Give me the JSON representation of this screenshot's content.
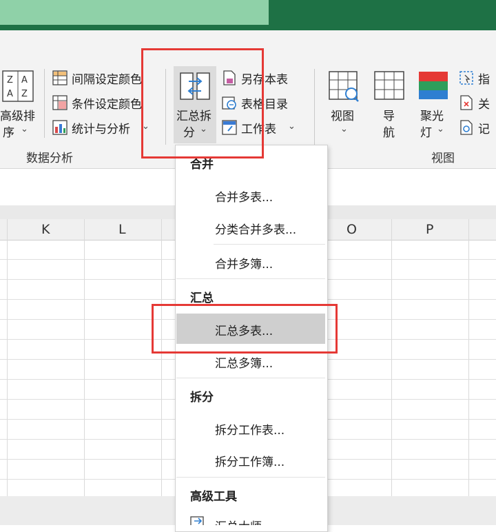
{
  "ribbon": {
    "sort": {
      "label_line1": "高级排",
      "label_line2": "序",
      "chevron": "⌄",
      "icon": "sort-az-icon"
    },
    "data_analysis": {
      "items": [
        {
          "label": "间隔设定颜色",
          "icon": "interval-color-icon"
        },
        {
          "label": "条件设定颜色",
          "icon": "condition-color-icon"
        },
        {
          "label": "统计与分析",
          "icon": "stats-analysis-icon",
          "chevron": "⌄"
        }
      ],
      "group_label": "数据分析"
    },
    "summary_split": {
      "label_line1": "汇总拆",
      "label_line2": "分",
      "chevron": "⌄",
      "icon": "merge-split-icon"
    },
    "table_tools": {
      "items": [
        {
          "label": "另存本表",
          "icon": "save-sheet-icon"
        },
        {
          "label": "表格目录",
          "icon": "table-catalog-icon"
        },
        {
          "label": "工作表",
          "icon": "worksheet-icon",
          "chevron": "⌄"
        }
      ]
    },
    "view": {
      "items": [
        {
          "label_line1": "视图",
          "label_line2": "⌄",
          "icon": "view-grid-icon"
        },
        {
          "label_line1": "导",
          "label_line2": "航",
          "icon": "navigation-icon"
        },
        {
          "label_line1": "聚光",
          "label_line2": "灯",
          "chevron": "⌄",
          "icon": "spotlight-icon"
        }
      ],
      "right_items": [
        {
          "label": "指",
          "icon": "pointer-icon"
        },
        {
          "label": "关",
          "icon": "close-panel-icon"
        },
        {
          "label": "记",
          "icon": "record-icon"
        }
      ],
      "group_label": "视图"
    }
  },
  "columns": [
    "K",
    "L",
    "O",
    "P"
  ],
  "dropdown": {
    "sections": [
      {
        "heading": "合并",
        "items": [
          "合并多表...",
          "分类合并多表...",
          "合并多簿..."
        ]
      },
      {
        "heading": "汇总",
        "items": [
          "汇总多表...",
          "汇总多簿..."
        ]
      },
      {
        "heading": "拆分",
        "items": [
          "拆分工作表...",
          "拆分工作簿..."
        ]
      },
      {
        "heading": "高级工具",
        "items": [
          "汇总大师"
        ]
      }
    ],
    "highlighted": "汇总多表..."
  },
  "colors": {
    "title_bar": "#1e7145",
    "annotation_red": "#e53935",
    "highlight": "#cfcfcf"
  }
}
